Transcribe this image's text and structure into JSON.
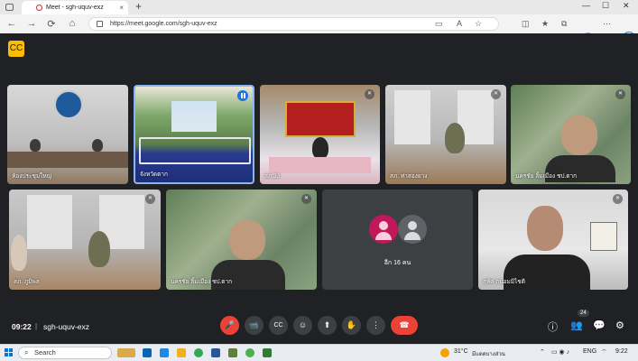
{
  "browser": {
    "tab_title": "Meet - sgh-uquv-exz",
    "tab_close": "×",
    "new_tab": "+",
    "url": "https://meet.google.com/sgh-uquv-exz",
    "win_min": "—",
    "win_max": "☐",
    "win_close": "✕",
    "bing_label": "b"
  },
  "tiles": [
    {
      "name": "ห้องประชุมใหญ่"
    },
    {
      "name": "จังหวัดตาก"
    },
    {
      "name": "สภ.33"
    },
    {
      "name": "สภ. ท่าสองยาง"
    },
    {
      "name": "นครชัย ลิ้มเมือง ชป.ตาก"
    },
    {
      "name": "สภ. ภูมิพล"
    },
    {
      "name": "นครชัย ลิ้มเมือง ชป.ตาก"
    },
    {
      "name": "อีก 16 คน"
    },
    {
      "name": "สุทัศ ถนอมมิไชติ"
    }
  ],
  "meeting": {
    "time": "09:22",
    "separator": "|",
    "code": "sgh-uquv-exz",
    "participant_count": "24"
  },
  "icons": {
    "mic_off": "🎤",
    "back": "←",
    "forward": "→",
    "reload": "⟳",
    "home": "⌂",
    "video_cam": "📹",
    "captions": "CC",
    "emoji": "☺",
    "present": "⬆",
    "hand": "✋",
    "more": "⋮",
    "end_call": "☎",
    "info": "ⓘ",
    "people": "👥",
    "chat": "💬",
    "activities": "⚙"
  },
  "taskbar": {
    "search": "Search",
    "weather": "31°C",
    "weather_desc": "มีแดดบางส่วน",
    "lang": "ENG",
    "time": "9:22"
  },
  "colors": {
    "meet_bg": "#202124",
    "accent": "#1a73e8",
    "danger": "#ea4335",
    "caption_badge": "#fbbc04"
  }
}
